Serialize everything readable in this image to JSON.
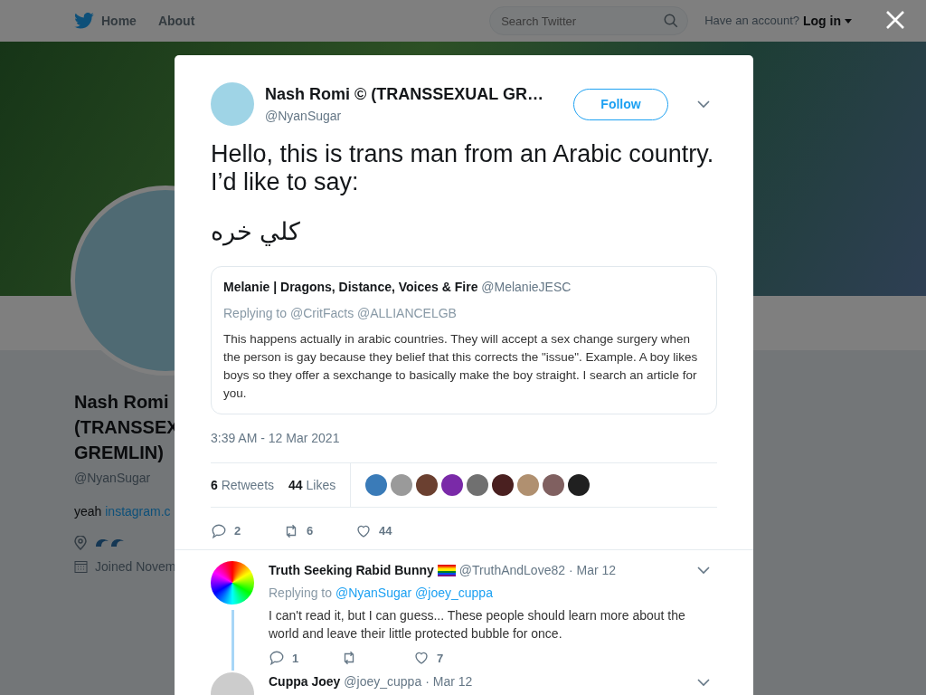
{
  "topbar": {
    "home": "Home",
    "about": "About",
    "search": {
      "placeholder": "Search Twitter"
    },
    "have_account": "Have an account?",
    "login": "Log in"
  },
  "profile": {
    "name_lines": [
      "Nash Romi",
      "(TRANSSEX",
      "GREMLIN)"
    ],
    "handle": "@NyanSugar",
    "bio": "yeah",
    "bio_link": "instagram.c",
    "joined": "Joined Novem"
  },
  "tweet": {
    "name": "Nash Romi © (TRANSSEXUAL GR…",
    "handle": "@NyanSugar",
    "follow": "Follow",
    "text_lines": [
      "Hello, this is trans man from an Arabic country. I’d like to say:",
      "كلي خره"
    ],
    "quote": {
      "name": "Melanie | Dragons, Distance, Voices & Fire",
      "handle": "@MelanieJESC",
      "replying": "Replying to",
      "mentions": [
        "@CritFacts",
        "@ALLIANCELGB"
      ],
      "text": "This happens actually in arabic countries. They will accept a sex change surgery when the person is gay because they belief that this corrects the \"issue\". Example. A boy likes boys so they offer a sexchange to basically make the boy straight. I search an article for you."
    },
    "time": "3:39 AM - 12 Mar 2021",
    "retweets": {
      "count": "6",
      "label": "Retweets"
    },
    "likes": {
      "count": "44",
      "label": "Likes"
    },
    "likers": [
      {
        "color": "#3a7bb8"
      },
      {
        "color": "#9a9a9a"
      },
      {
        "color": "#6b4030"
      },
      {
        "color": "#7a2aa8"
      },
      {
        "color": "#707070"
      },
      {
        "color": "#4a2020"
      },
      {
        "color": "#b09070"
      },
      {
        "color": "#806060"
      },
      {
        "color": "#202020"
      }
    ],
    "actions": {
      "replies": "2",
      "retweets": "6",
      "likes": "44"
    }
  },
  "replies": [
    {
      "name": "Truth Seeking Rabid Bunny",
      "handle": "@TruthAndLove82",
      "date": "· Mar 12",
      "flag": true,
      "replying": "Replying to",
      "mentions": [
        "@NyanSugar",
        "@joey_cuppa"
      ],
      "text": "I can't read it, but I can guess... These people should learn more about the world and leave their little protected bubble for once.",
      "replies": "1",
      "likes": "7",
      "thread": true
    },
    {
      "name": "Cuppa Joey",
      "handle": "@joey_cuppa",
      "date": "· Mar 12",
      "flag": false,
      "thread": false
    }
  ]
}
